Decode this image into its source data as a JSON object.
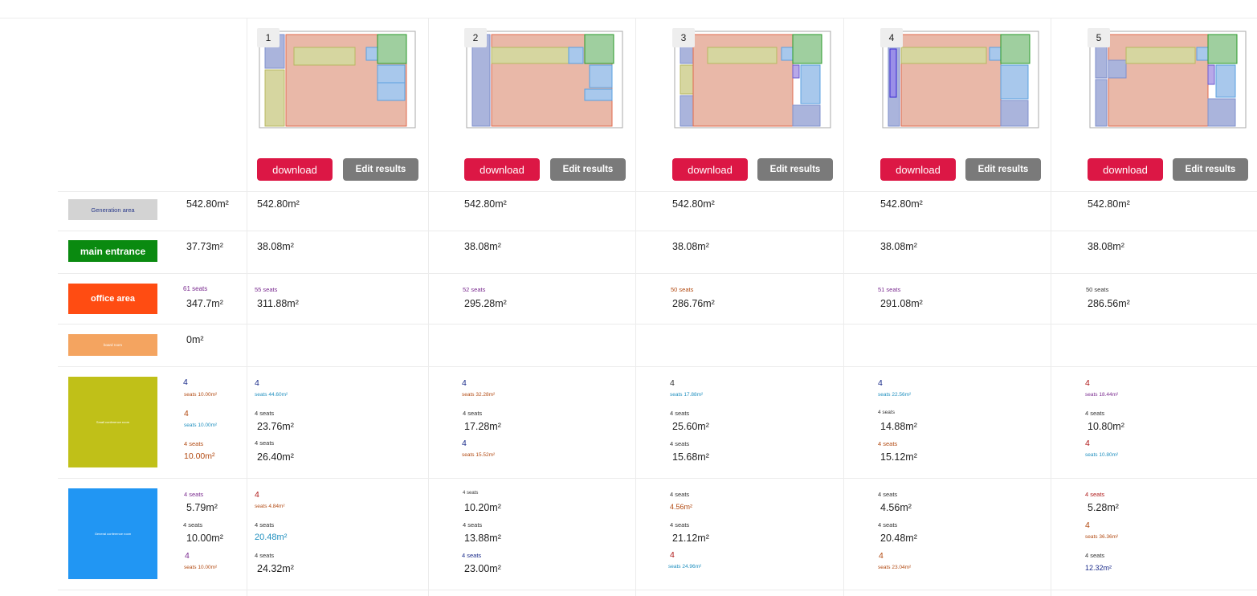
{
  "colors": {
    "generation": "#d3d3d3",
    "entrance": "#0a8a10",
    "office": "#ff4c12",
    "boardroom": "#f4a460",
    "small_conf": "#c0c018",
    "conf": "#2196f3",
    "download": "#dc1745",
    "edit": "#7a7a7a",
    "purple": "#7a2b8f",
    "navy": "#1a2b8a",
    "teal": "#1f8fbf",
    "brown": "#b24a12",
    "dark": "#333333"
  },
  "rows": {
    "generation_label": "Generation area",
    "entrance_label": "main entrance",
    "office_label": "office area",
    "boardroom_label": "board room",
    "small_conf_label": "Small conference room",
    "conf_label": "General conference room"
  },
  "target": {
    "generation": "542.80m²",
    "entrance": "37.73m²",
    "office_seats": "61 seats",
    "office": "347.7m²",
    "boardroom": "0m²",
    "sc1_count": "4",
    "sc1_sub": "seats 10.00m²",
    "sc2_count": "4",
    "sc2_sub": "seats 10.00m²",
    "sc3_small": "4 seats",
    "sc3_area": "10.00m²",
    "c1_small": "4 seats",
    "c1_area": "5.79m²",
    "c2_small": "4 seats",
    "c2_area": "10.00m²",
    "c3_count": "4",
    "c3_sub": "seats 10.00m²"
  },
  "actions": {
    "download": "download",
    "edit": "Edit results"
  },
  "results": [
    {
      "num": "1",
      "generation": "542.80m²",
      "entrance": "38.08m²",
      "office_seats": "55 seats",
      "office": "311.88m²",
      "sc1_count": "4",
      "sc1_sub": "seats 44.60m²",
      "sc2_small": "4 seats",
      "sc2_area": "23.76m²",
      "sc3_small": "4 seats",
      "sc3_area": "26.40m²",
      "c1_count": "4",
      "c1_sub": "seats 4.84m²",
      "c2_small": "4 seats",
      "c2_area": "20.48m²",
      "c3_small": "4 seats",
      "c3_area": "24.32m²"
    },
    {
      "num": "2",
      "generation": "542.80m²",
      "entrance": "38.08m²",
      "office_seats": "52 seats",
      "office": "295.28m²",
      "sc1_count": "4",
      "sc1_sub": "seats 32.28m²",
      "sc2_small": "4 seats",
      "sc2_area": "17.28m²",
      "sc3_count": "4",
      "sc3_sub": "seats 15.52m²",
      "c1_small": "4 seats",
      "c1_area": "10.20m²",
      "c2_small": "4 seats",
      "c2_area": "13.88m²",
      "c3_small": "4 seats",
      "c3_area": "23.00m²"
    },
    {
      "num": "3",
      "generation": "542.80m²",
      "entrance": "38.08m²",
      "office_seats": "50 seats",
      "office": "286.76m²",
      "sc1_count": "4",
      "sc1_sub": "seats 17.88m²",
      "sc2_small": "4 seats",
      "sc2_area": "25.60m²",
      "sc3_small": "4 seats",
      "sc3_area": "15.68m²",
      "c1_small": "4 seats",
      "c1_area": "4.56m²",
      "c2_small": "4 seats",
      "c2_area": "21.12m²",
      "c3_count": "4",
      "c3_sub": "seats 24.96m²"
    },
    {
      "num": "4",
      "generation": "542.80m²",
      "entrance": "38.08m²",
      "office_seats": "51 seats",
      "office": "291.08m²",
      "sc1_count": "4",
      "sc1_sub": "seats 22.56m²",
      "sc2_small": "4 seats",
      "sc2_area": "14.88m²",
      "sc3_small": "4 seats",
      "sc3_area": "15.12m²",
      "c1_small": "4 seats",
      "c1_area": "4.56m²",
      "c2_small": "4 seats",
      "c2_area": "20.48m²",
      "c3_count": "4",
      "c3_sub": "seats 23.04m²"
    },
    {
      "num": "5",
      "generation": "542.80m²",
      "entrance": "38.08m²",
      "office_seats": "50 seats",
      "office": "286.56m²",
      "sc1_count": "4",
      "sc1_sub": "seats 18.44m²",
      "sc2_small": "4 seats",
      "sc2_area": "10.80m²",
      "sc3_count": "4",
      "sc3_sub": "seats 10.80m²",
      "c1_small": "4 seats",
      "c1_area": "5.28m²",
      "c2_count": "4",
      "c2_sub": "seats 36.36m²",
      "c3_small": "4 seats",
      "c3_area": "12.32m²"
    }
  ]
}
